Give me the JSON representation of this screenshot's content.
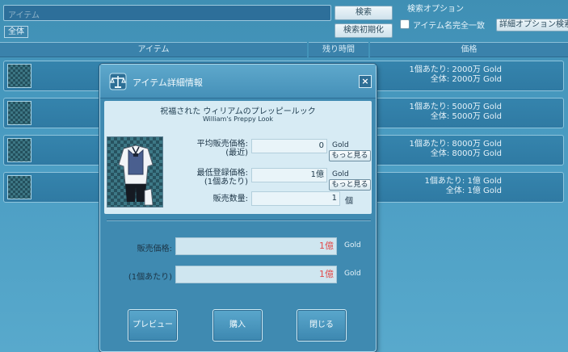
{
  "search": {
    "placeholder": "アイテム",
    "search_button": "検索",
    "reset_button": "検索初期化",
    "all_tab": "全体",
    "options_title": "検索オプション",
    "exact_match_label": "アイテム名完全一致",
    "detail_options_button": "詳細オプション検索"
  },
  "columns": [
    "アイテム",
    "残り時間",
    "価格"
  ],
  "listings": [
    {
      "price_per": "1個あたり: 2000万 Gold",
      "price_total": "全体: 2000万 Gold"
    },
    {
      "price_per": "1個あたり: 5000万 Gold",
      "price_total": "全体: 5000万 Gold"
    },
    {
      "price_per": "1個あたり: 8000万 Gold",
      "price_total": "全体: 8000万 Gold"
    },
    {
      "price_per": "1個あたり: 1億 Gold",
      "price_total": "全体: 1億 Gold"
    }
  ],
  "modal": {
    "title": "アイテム詳細情報",
    "item_name_jp": "祝福された ウィリアムのプレッピールック",
    "item_name_en": "William's Preppy Look",
    "avg_price_label": "平均販売価格:",
    "avg_price_sub": "(最近)",
    "avg_price_value": "0",
    "avg_price_unit": "Gold",
    "min_price_label": "最低登録価格:",
    "min_price_sub": "(1個あたり)",
    "min_price_value": "1億",
    "min_price_unit": "Gold",
    "more_button": "もっと見る",
    "quantity_label": "販売数量:",
    "quantity_value": "1",
    "quantity_unit": "個",
    "sale_price_label": "販売価格:",
    "sale_price_value": "1億",
    "sale_price_unit": "Gold",
    "per_unit_label": "(1個あたり)",
    "per_unit_value": "1億",
    "per_unit_unit": "Gold",
    "preview_button": "プレビュー",
    "buy_button": "購入",
    "close_button": "閉じる"
  },
  "icons": {
    "balance": "balance-scale-icon",
    "close": "close-icon"
  }
}
